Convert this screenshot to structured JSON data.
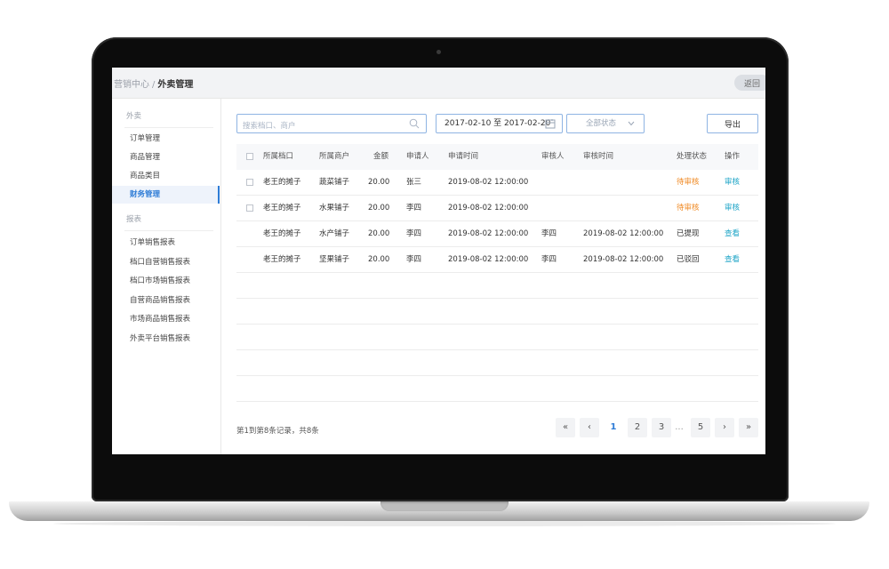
{
  "breadcrumb": {
    "parent": "营销中心",
    "separator": "/",
    "current": "外卖管理"
  },
  "back_label": "返回",
  "sidebar": {
    "group1": "外卖",
    "group1_items": [
      "订单管理",
      "商品管理",
      "商品类目",
      "财务管理"
    ],
    "active_item": "财务管理",
    "group2": "报表",
    "group2_items": [
      "订单销售报表",
      "档口自营销售报表",
      "档口市场销售报表",
      "自营商品销售报表",
      "市场商品销售报表",
      "外卖平台销售报表"
    ]
  },
  "toolbar": {
    "search_placeholder": "搜索档口、商户",
    "date_range": "2017-02-10 至 2017-02-20",
    "status_select": "全部状态",
    "export_label": "导出"
  },
  "table": {
    "headers": [
      "所属档口",
      "所属商户",
      "金额",
      "申请人",
      "申请时间",
      "审核人",
      "审核时间",
      "处理状态",
      "操作"
    ],
    "rows": [
      [
        "老王的摊子",
        "蔬菜铺子",
        "20.00",
        "张三",
        "2019-08-02 12:00:00",
        "",
        "",
        "待审核",
        "审核"
      ],
      [
        "老王的摊子",
        "水果铺子",
        "20.00",
        "李四",
        "2019-08-02 12:00:00",
        "",
        "",
        "待审核",
        "审核"
      ],
      [
        "老王的摊子",
        "水产铺子",
        "20.00",
        "李四",
        "2019-08-02 12:00:00",
        "李四",
        "2019-08-02 12:00:00",
        "已提现",
        "查看"
      ],
      [
        "老王的摊子",
        "坚果铺子",
        "20.00",
        "李四",
        "2019-08-02 12:00:00",
        "李四",
        "2019-08-02 12:00:00",
        "已驳回",
        "查看"
      ]
    ]
  },
  "footer": {
    "summary": "第1到第8条记录，共8条"
  },
  "pagination": {
    "first": "«",
    "prev": "‹",
    "pages": [
      "1",
      "2",
      "3"
    ],
    "ellipsis": "...",
    "last_page": "5",
    "next": "›",
    "last": "»",
    "current": "1"
  },
  "colors": {
    "accent": "#2e7cd6",
    "pending": "#f08a24",
    "action": "#1aa3c6"
  }
}
